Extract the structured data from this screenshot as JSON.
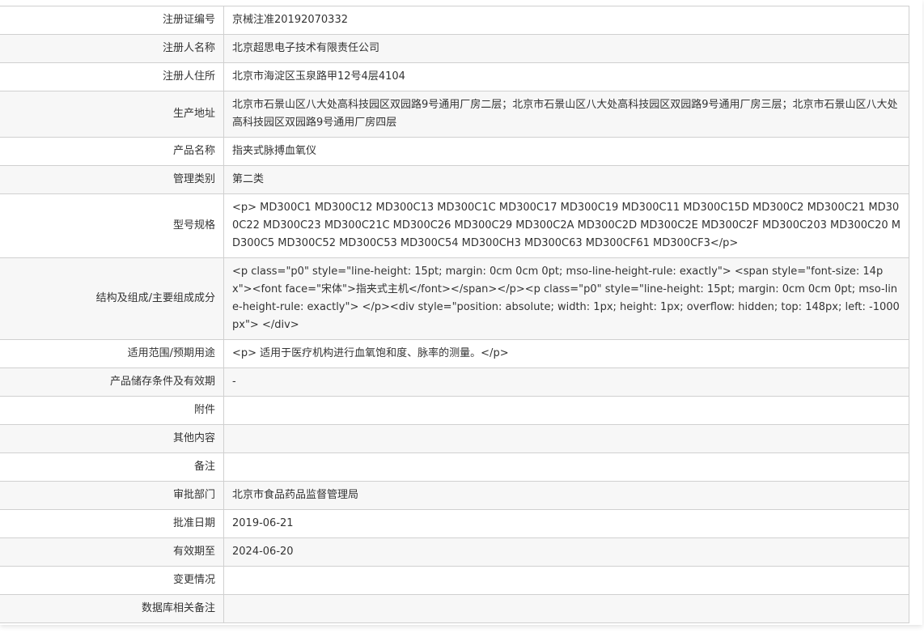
{
  "rows": [
    {
      "label": "注册证编号",
      "value": "京械注准20192070332"
    },
    {
      "label": "注册人名称",
      "value": "北京超思电子技术有限责任公司"
    },
    {
      "label": "注册人住所",
      "value": "北京市海淀区玉泉路甲12号4层4104"
    },
    {
      "label": "生产地址",
      "value": "北京市石景山区八大处高科技园区双园路9号通用厂房二层；北京市石景山区八大处高科技园区双园路9号通用厂房三层；北京市石景山区八大处高科技园区双园路9号通用厂房四层"
    },
    {
      "label": "产品名称",
      "value": "指夹式脉搏血氧仪"
    },
    {
      "label": "管理类别",
      "value": "第二类"
    },
    {
      "label": "型号规格",
      "value": "<p> MD300C1 MD300C12 MD300C13 MD300C1C MD300C17 MD300C19 MD300C11 MD300C15D MD300C2 MD300C21 MD300C22 MD300C23 MD300C21C MD300C26 MD300C29 MD300C2A MD300C2D MD300C2E MD300C2F MD300C203 MD300C20 MD300C5 MD300C52 MD300C53 MD300C54 MD300CH3 MD300C63 MD300CF61 MD300CF3</p>"
    },
    {
      "label": "结构及组成/主要组成成分",
      "value": "<p class=\"p0\" style=\"line-height: 15pt; margin: 0cm 0cm 0pt; mso-line-height-rule: exactly\"> <span style=\"font-size: 14px\"><font face=\"宋体\">指夹式主机</font></span></p><p class=\"p0\" style=\"line-height: 15pt; margin: 0cm 0cm 0pt; mso-line-height-rule: exactly\"> </p><div style=\"position: absolute; width: 1px; height: 1px; overflow: hidden; top: 148px; left: -1000px\"> </div>"
    },
    {
      "label": "适用范围/预期用途",
      "value": "<p> 适用于医疗机构进行血氧饱和度、脉率的测量。</p>"
    },
    {
      "label": "产品储存条件及有效期",
      "value": "-"
    },
    {
      "label": "附件",
      "value": ""
    },
    {
      "label": "其他内容",
      "value": ""
    },
    {
      "label": "备注",
      "value": ""
    },
    {
      "label": "审批部门",
      "value": "北京市食品药品监督管理局"
    },
    {
      "label": "批准日期",
      "value": "2019-06-21"
    },
    {
      "label": "有效期至",
      "value": "2024-06-20"
    },
    {
      "label": "变更情况",
      "value": ""
    },
    {
      "label": "数据库相关备注",
      "value": ""
    }
  ]
}
